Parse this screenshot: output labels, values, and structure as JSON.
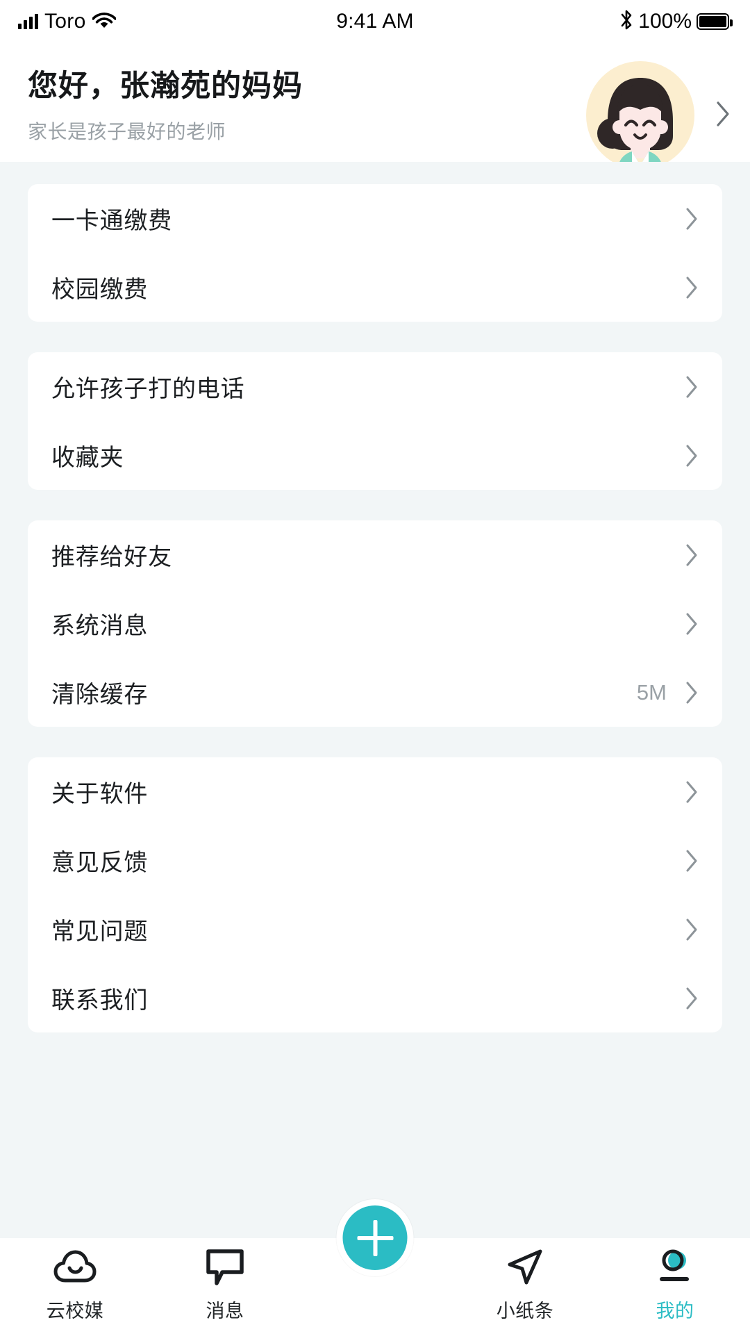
{
  "status_bar": {
    "carrier": "Toro",
    "time": "9:41 AM",
    "battery_percent": "100%",
    "signal_icon": "cellular-signal-icon",
    "wifi_icon": "wifi-icon",
    "bluetooth_icon": "bluetooth-icon",
    "battery_icon": "battery-icon"
  },
  "header": {
    "greeting": "您好，张瀚苑的妈妈",
    "subtitle": "家长是孩子最好的老师",
    "avatar_icon": "avatar",
    "chevron_icon": "chevron-right-icon",
    "avatar_colors": {
      "background": "#fceecf",
      "hair": "#2f2727",
      "skin": "#fce8e6",
      "clothes": "#7fd6c1"
    }
  },
  "sections": [
    {
      "rows": [
        {
          "label": "一卡通缴费",
          "value": ""
        },
        {
          "label": "校园缴费",
          "value": ""
        }
      ]
    },
    {
      "rows": [
        {
          "label": "允许孩子打的电话",
          "value": ""
        },
        {
          "label": "收藏夹",
          "value": ""
        }
      ]
    },
    {
      "rows": [
        {
          "label": "推荐给好友",
          "value": ""
        },
        {
          "label": "系统消息",
          "value": ""
        },
        {
          "label": "清除缓存",
          "value": "5M"
        }
      ]
    },
    {
      "rows": [
        {
          "label": "关于软件",
          "value": ""
        },
        {
          "label": "意见反馈",
          "value": ""
        },
        {
          "label": "常见问题",
          "value": ""
        },
        {
          "label": "联系我们",
          "value": ""
        }
      ]
    }
  ],
  "tabbar": {
    "accent_color": "#2bbcc4",
    "fab": {
      "icon": "plus-icon",
      "label": ""
    },
    "tabs": [
      {
        "label": "云校媒",
        "icon": "cloud-icon",
        "active": false
      },
      {
        "label": "消息",
        "icon": "message-bubble-icon",
        "active": false
      },
      {
        "label": "小纸条",
        "icon": "paper-plane-icon",
        "active": false
      },
      {
        "label": "我的",
        "icon": "profile-icon",
        "active": true
      }
    ]
  }
}
